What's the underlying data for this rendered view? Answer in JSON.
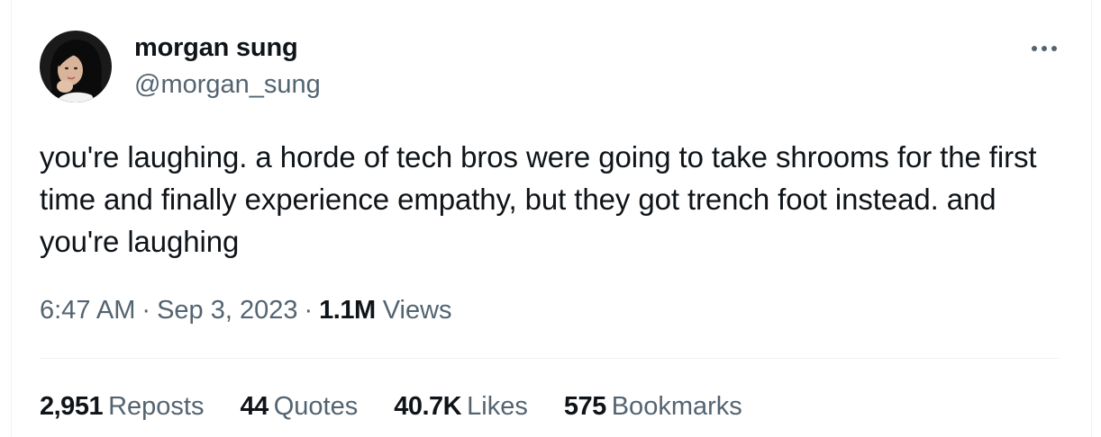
{
  "author": {
    "name": "morgan sung",
    "handle": "@morgan_sung",
    "avatar_icon": "profile-photo"
  },
  "tweet": {
    "text": "you're laughing. a horde of tech bros were going to take shrooms for the first time and finally experience empathy, but they got trench foot instead. and you're laughing",
    "time": "6:47 AM",
    "date": "Sep 3, 2023",
    "separator": "·",
    "views_count": "1.1M",
    "views_label": "Views"
  },
  "stats": {
    "reposts": {
      "count": "2,951",
      "label": "Reposts"
    },
    "quotes": {
      "count": "44",
      "label": "Quotes"
    },
    "likes": {
      "count": "40.7K",
      "label": "Likes"
    },
    "bookmarks": {
      "count": "575",
      "label": "Bookmarks"
    }
  },
  "icons": {
    "more": "more-horizontal-icon"
  },
  "colors": {
    "text_primary": "#0f1419",
    "text_secondary": "#536471",
    "divider": "#eff3f4",
    "background": "#ffffff"
  }
}
